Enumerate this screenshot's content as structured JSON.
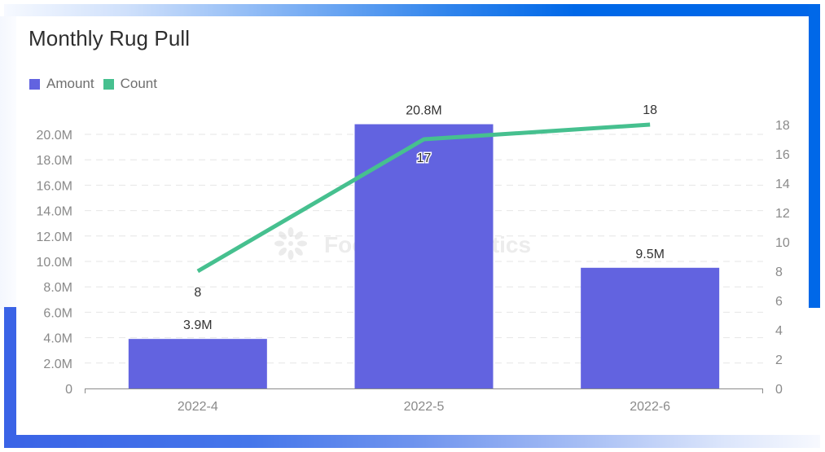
{
  "colors": {
    "amount": "#6263e0",
    "count": "#46c08f",
    "frame_blue": "#0068e8",
    "grid": "#e6e6e6",
    "axis": "#8c8c8c"
  },
  "watermark": "Footprint Analytics",
  "chart_data": {
    "type": "bar",
    "title": "Monthly Rug Pull",
    "categories": [
      "2022-4",
      "2022-5",
      "2022-6"
    ],
    "series": [
      {
        "name": "Amount",
        "type": "bar",
        "axis": "left",
        "values": [
          3900000,
          20800000,
          9500000
        ],
        "labels": [
          "3.9M",
          "20.8M",
          "9.5M"
        ]
      },
      {
        "name": "Count",
        "type": "line",
        "axis": "right",
        "values": [
          8,
          17,
          18
        ],
        "labels": [
          "8",
          "17",
          "18"
        ]
      }
    ],
    "legend": [
      "Amount",
      "Count"
    ],
    "legend_position": "top-left",
    "y_left": {
      "ylim": [
        0,
        20000000
      ],
      "ticks": [
        0,
        2000000,
        4000000,
        6000000,
        8000000,
        10000000,
        12000000,
        14000000,
        16000000,
        18000000,
        20000000
      ],
      "tick_labels": [
        "0",
        "2.0M",
        "4.0M",
        "6.0M",
        "8.0M",
        "10.0M",
        "12.0M",
        "14.0M",
        "16.0M",
        "18.0M",
        "20.0M"
      ]
    },
    "y_right": {
      "ylim": [
        0,
        18
      ],
      "ticks": [
        0,
        2,
        4,
        6,
        8,
        10,
        12,
        14,
        16,
        18
      ],
      "tick_labels": [
        "0",
        "2",
        "4",
        "6",
        "8",
        "10",
        "12",
        "14",
        "16",
        "18"
      ]
    },
    "xlabel": "",
    "ylabel": "",
    "grid": true
  }
}
